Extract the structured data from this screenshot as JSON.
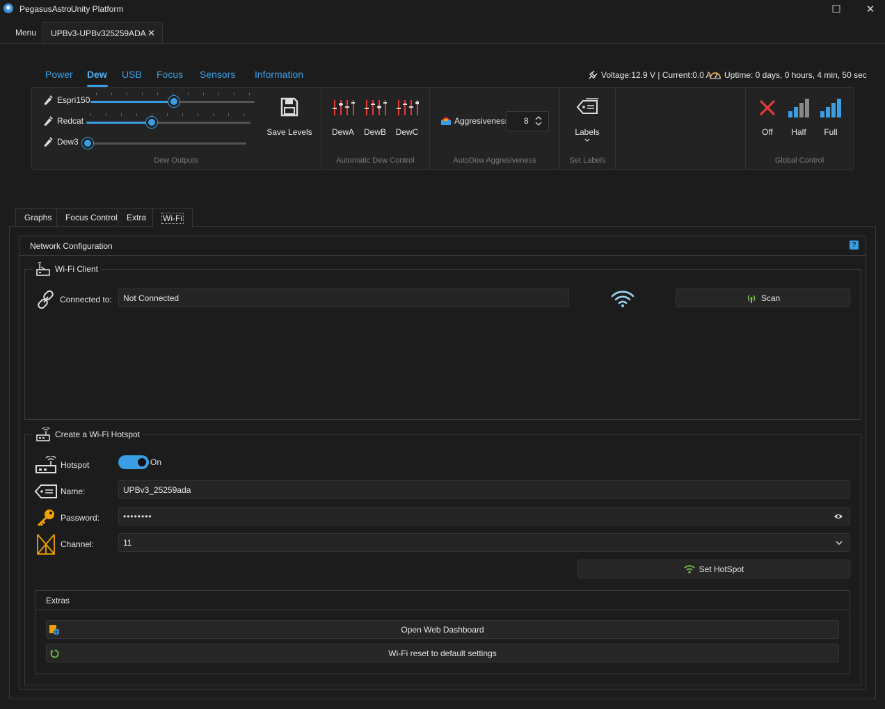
{
  "window": {
    "title_left": "PegasusAstro",
    "title_right": "Unity Platform",
    "maximize_glyph": "☐",
    "close_glyph": "✕"
  },
  "doc_tabs": {
    "menu_label": "Menu",
    "device_tab_label": "UPBv3-UPBv325259ADA",
    "close_glyph": "✕"
  },
  "device_nav": {
    "items": [
      "Power",
      "Dew",
      "USB",
      "Focus",
      "Sensors",
      "Information"
    ],
    "active": "Dew"
  },
  "status": {
    "voltage_current": "Voltage:12.9 V | Current:0.0 A",
    "uptime": "Uptime: 0 days, 0 hours, 4 min, 50 sec"
  },
  "ribbon": {
    "dew_outputs": {
      "label": "Dew Outputs",
      "sliders": [
        {
          "name": "Espri150",
          "value_fraction": 0.5
        },
        {
          "name": "Redcat",
          "value_fraction": 0.4
        },
        {
          "name": "Dew3",
          "value_fraction": 0.0
        }
      ],
      "save_label": "Save Levels"
    },
    "automatic_dew": {
      "label": "Automatic Dew Control",
      "buttons": [
        "DewA",
        "DewB",
        "DewC"
      ]
    },
    "autodew_aggr": {
      "label": "AutoDew Aggresiveness",
      "field_label": "Aggresiveness",
      "value": "8"
    },
    "set_labels": {
      "label": "Set Labels",
      "button": "Labels"
    },
    "global_control": {
      "label": "Global Control",
      "buttons": [
        "Off",
        "Half",
        "Full"
      ]
    }
  },
  "page_tabs": {
    "items": [
      "Graphs",
      "Focus Control",
      "Extra",
      "Wi-Fi"
    ],
    "active": "Wi-Fi"
  },
  "network": {
    "title": "Network Configuration",
    "client": {
      "legend": "Wi-Fi Client",
      "connected_label": "Connected to:",
      "connected_value": "Not Connected",
      "scan_label": "Scan"
    },
    "hotspot": {
      "legend": "Create a Wi-Fi Hotspot",
      "hotspot_label": "Hotspot",
      "toggle_state": "On",
      "name_label": "Name:",
      "name_value": "UPBv3_25259ada",
      "password_label": "Password:",
      "password_value": "••••••••",
      "channel_label": "Channel:",
      "channel_value": "11",
      "set_hotspot_label": "Set HotSpot"
    },
    "extras": {
      "legend": "Extras",
      "open_dashboard_label": "Open Web Dashboard",
      "reset_label": "Wi-Fi reset to default settings"
    }
  },
  "colors": {
    "accent": "#3a9ee4",
    "dew_icon": "#e53935",
    "off_icon": "#e53935",
    "key_icon": "#f2a200",
    "wifi_green": "#7ac943"
  }
}
